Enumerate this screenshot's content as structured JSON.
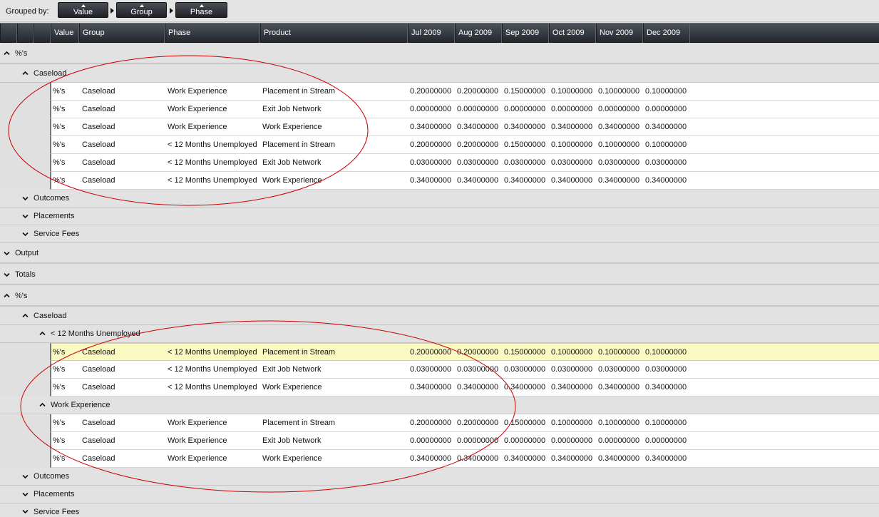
{
  "groupbar": {
    "label": "Grouped by:",
    "chips": [
      "Value",
      "Group",
      "Phase"
    ]
  },
  "columns": [
    "Value",
    "Group",
    "Phase",
    "Product",
    "Jul 2009",
    "Aug 2009",
    "Sep 2009",
    "Oct 2009",
    "Nov 2009",
    "Dec 2009"
  ],
  "groups": {
    "g1": "%'s",
    "g1_caseload": "Caseload",
    "g1_outcomes": "Outcomes",
    "g1_placements": "Placements",
    "g1_servicefees": "Service Fees",
    "output": "Output",
    "totals": "Totals",
    "g2": "%'s",
    "g2_caseload": "Caseload",
    "g2_lt12": "< 12 Months Unemployed",
    "g2_workexp": "Work Experience",
    "g2_outcomes": "Outcomes",
    "g2_placements": "Placements",
    "g2_servicefees": "Service Fees"
  },
  "rows": [
    [
      "%'s",
      "Caseload",
      "Work Experience",
      "Placement in Stream",
      "0.20000000",
      "0.20000000",
      "0.15000000",
      "0.10000000",
      "0.10000000",
      "0.10000000"
    ],
    [
      "%'s",
      "Caseload",
      "Work Experience",
      "Exit Job Network",
      "0.00000000",
      "0.00000000",
      "0.00000000",
      "0.00000000",
      "0.00000000",
      "0.00000000"
    ],
    [
      "%'s",
      "Caseload",
      "Work Experience",
      "Work Experience",
      "0.34000000",
      "0.34000000",
      "0.34000000",
      "0.34000000",
      "0.34000000",
      "0.34000000"
    ],
    [
      "%'s",
      "Caseload",
      "< 12 Months Unemployed",
      "Placement in Stream",
      "0.20000000",
      "0.20000000",
      "0.15000000",
      "0.10000000",
      "0.10000000",
      "0.10000000"
    ],
    [
      "%'s",
      "Caseload",
      "< 12 Months Unemployed",
      "Exit Job Network",
      "0.03000000",
      "0.03000000",
      "0.03000000",
      "0.03000000",
      "0.03000000",
      "0.03000000"
    ],
    [
      "%'s",
      "Caseload",
      "< 12 Months Unemployed",
      "Work Experience",
      "0.34000000",
      "0.34000000",
      "0.34000000",
      "0.34000000",
      "0.34000000",
      "0.34000000"
    ],
    [
      "%'s",
      "Caseload",
      "< 12 Months Unemployed",
      "Placement in Stream",
      "0.20000000",
      "0.20000000",
      "0.15000000",
      "0.10000000",
      "0.10000000",
      "0.10000000"
    ],
    [
      "%'s",
      "Caseload",
      "< 12 Months Unemployed",
      "Exit Job Network",
      "0.03000000",
      "0.03000000",
      "0.03000000",
      "0.03000000",
      "0.03000000",
      "0.03000000"
    ],
    [
      "%'s",
      "Caseload",
      "< 12 Months Unemployed",
      "Work Experience",
      "0.34000000",
      "0.34000000",
      "0.34000000",
      "0.34000000",
      "0.34000000",
      "0.34000000"
    ],
    [
      "%'s",
      "Caseload",
      "Work Experience",
      "Placement in Stream",
      "0.20000000",
      "0.20000000",
      "0.15000000",
      "0.10000000",
      "0.10000000",
      "0.10000000"
    ],
    [
      "%'s",
      "Caseload",
      "Work Experience",
      "Exit Job Network",
      "0.00000000",
      "0.00000000",
      "0.00000000",
      "0.00000000",
      "0.00000000",
      "0.00000000"
    ],
    [
      "%'s",
      "Caseload",
      "Work Experience",
      "Work Experience",
      "0.34000000",
      "0.34000000",
      "0.34000000",
      "0.34000000",
      "0.34000000",
      "0.34000000"
    ]
  ],
  "colors": {
    "header_bg": "#2b2f35",
    "selected_row": "#fbf9c2",
    "annotation": "#cc0000"
  }
}
